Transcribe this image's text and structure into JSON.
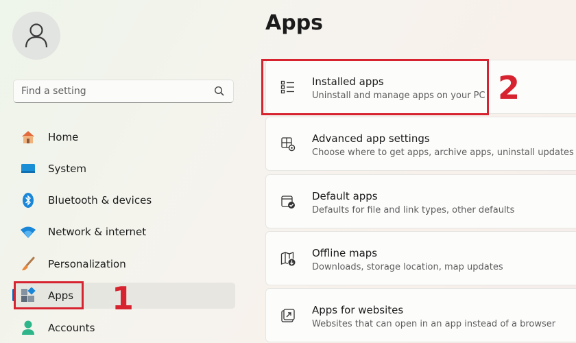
{
  "search": {
    "placeholder": "Find a setting"
  },
  "sidebar": {
    "items": [
      {
        "label": "Home",
        "icon": "home-icon"
      },
      {
        "label": "System",
        "icon": "system-icon"
      },
      {
        "label": "Bluetooth & devices",
        "icon": "bluetooth-icon"
      },
      {
        "label": "Network & internet",
        "icon": "wifi-icon"
      },
      {
        "label": "Personalization",
        "icon": "brush-icon"
      },
      {
        "label": "Apps",
        "icon": "apps-icon",
        "selected": true
      },
      {
        "label": "Accounts",
        "icon": "accounts-icon"
      }
    ]
  },
  "main": {
    "title": "Apps",
    "cards": [
      {
        "title": "Installed apps",
        "desc": "Uninstall and manage apps on your PC",
        "icon": "list-icon"
      },
      {
        "title": "Advanced app settings",
        "desc": "Choose where to get apps, archive apps, uninstall updates",
        "icon": "app-settings-icon"
      },
      {
        "title": "Default apps",
        "desc": "Defaults for file and link types, other defaults",
        "icon": "default-apps-icon"
      },
      {
        "title": "Offline maps",
        "desc": "Downloads, storage location, map updates",
        "icon": "offline-maps-icon"
      },
      {
        "title": "Apps for websites",
        "desc": "Websites that can open in an app instead of a browser",
        "icon": "open-link-icon"
      }
    ]
  },
  "annotations": {
    "step1": "1",
    "step2": "2"
  },
  "colors": {
    "accent": "#0067c0",
    "highlight": "#d6232f"
  }
}
